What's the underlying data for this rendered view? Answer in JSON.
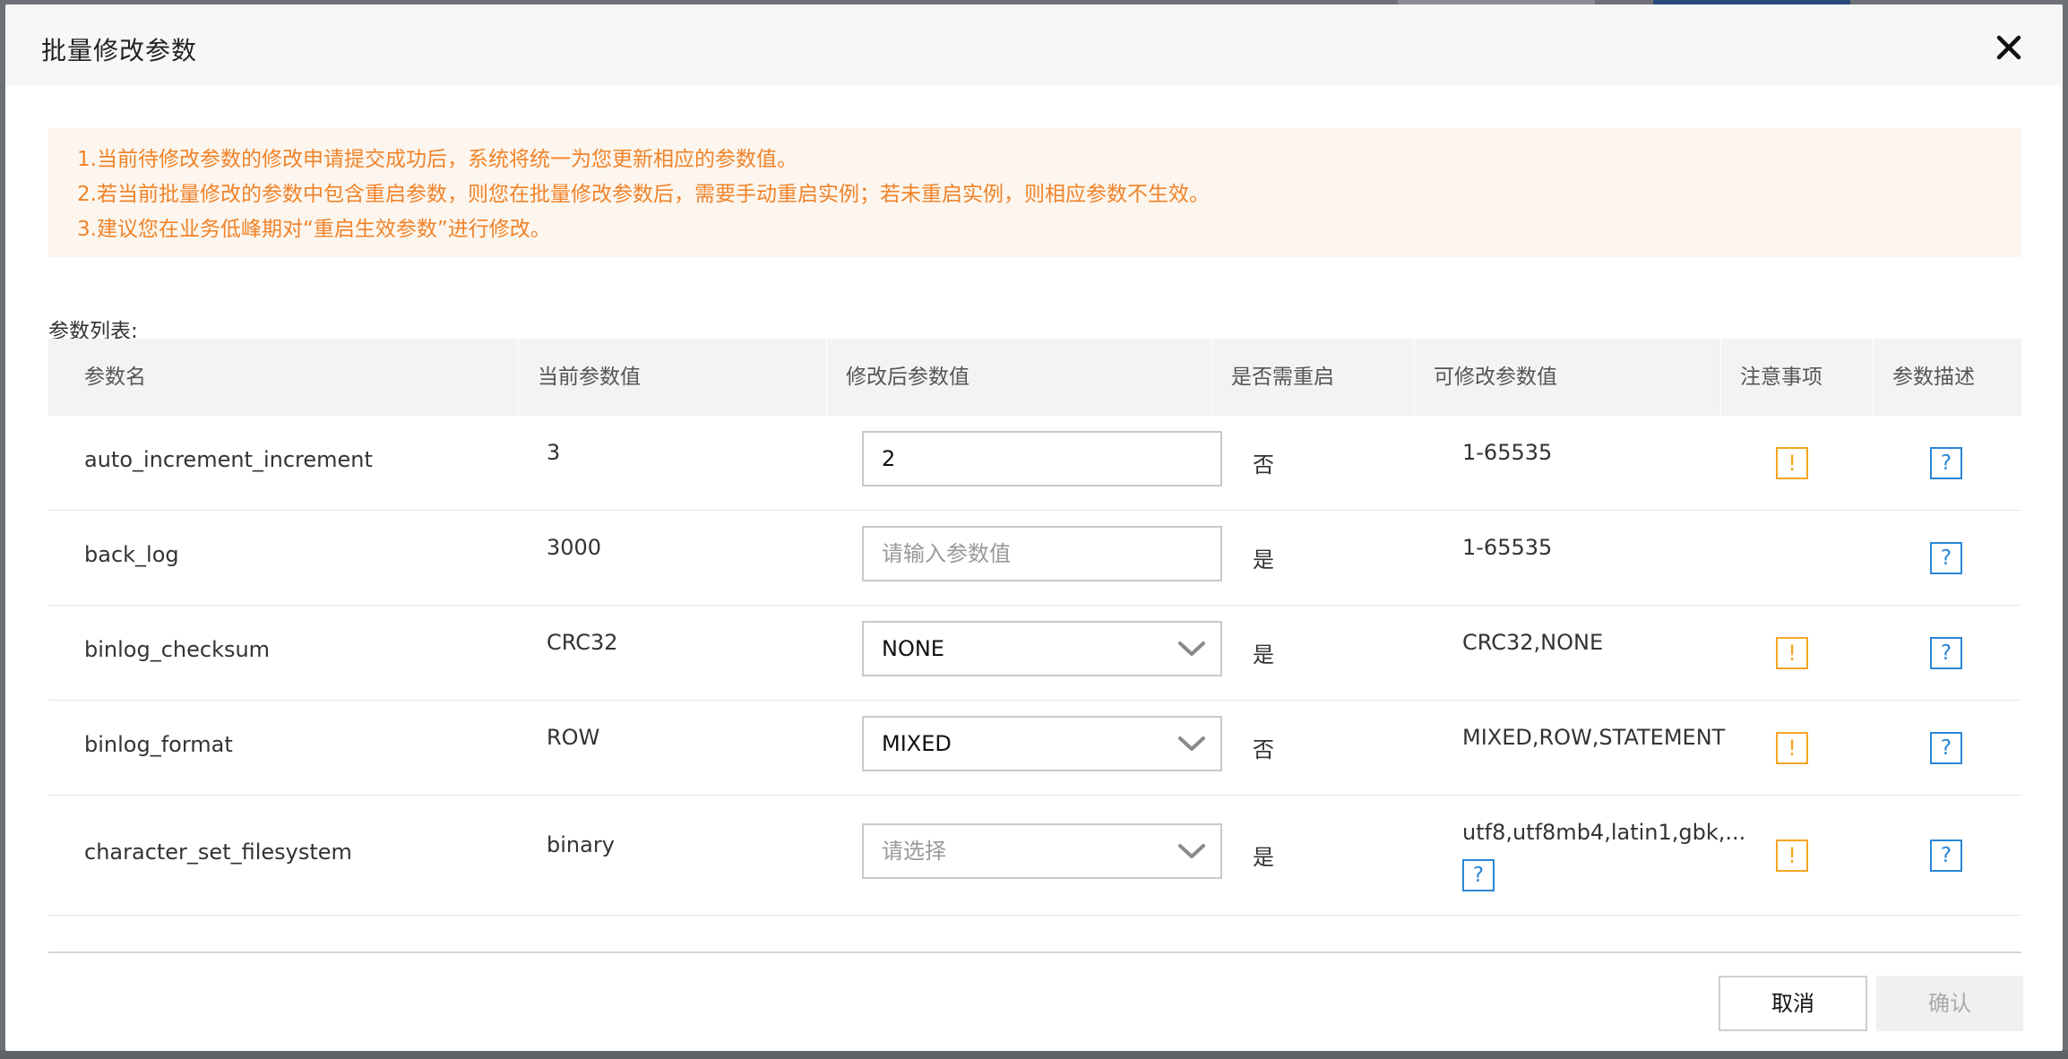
{
  "dialog": {
    "title": "批量修改参数",
    "close_icon": "close-icon",
    "notice": [
      "1.当前待修改参数的修改申请提交成功后，系统将统一为您更新相应的参数值。",
      "2.若当前批量修改的参数中包含重启参数，则您在批量修改参数后，需要手动重启实例；若未重启实例，则相应参数不生效。",
      "3.建议您在业务低峰期对“重启生效参数”进行修改。"
    ],
    "list_label": "参数列表:",
    "columns": [
      "参数名",
      "当前参数值",
      "修改后参数值",
      "是否需重启",
      "可修改参数值",
      "注意事项",
      "参数描述"
    ],
    "rows": [
      {
        "name": "auto_increment_increment",
        "current": "3",
        "control": "input",
        "value": "2",
        "placeholder": "请输入参数值",
        "restart": "否",
        "allowed": "1-65535",
        "has_warning": true,
        "has_help_in_allowed": false
      },
      {
        "name": "back_log",
        "current": "3000",
        "control": "input",
        "value": "",
        "placeholder": "请输入参数值",
        "restart": "是",
        "allowed": "1-65535",
        "has_warning": false,
        "has_help_in_allowed": false
      },
      {
        "name": "binlog_checksum",
        "current": "CRC32",
        "control": "select",
        "value": "NONE",
        "placeholder": "请选择",
        "restart": "是",
        "allowed": "CRC32,NONE",
        "has_warning": true,
        "has_help_in_allowed": false
      },
      {
        "name": "binlog_format",
        "current": "ROW",
        "control": "select",
        "value": "MIXED",
        "placeholder": "请选择",
        "restart": "否",
        "allowed": "MIXED,ROW,STATEMENT",
        "has_warning": true,
        "has_help_in_allowed": false
      },
      {
        "name": "character_set_filesystem",
        "current": "binary",
        "control": "select",
        "value": "",
        "placeholder": "请选择",
        "restart": "是",
        "allowed": "utf8,utf8mb4,latin1,gbk,...",
        "has_warning": true,
        "has_help_in_allowed": true
      }
    ],
    "icons": {
      "warning": "!",
      "help": "?"
    },
    "colors": {
      "notice_text": "#f0832a",
      "notice_bg": "#fdf6ee",
      "warning": "#f5a623",
      "help": "#2a86d8"
    },
    "buttons": {
      "cancel": "取消",
      "confirm": "确认"
    }
  }
}
